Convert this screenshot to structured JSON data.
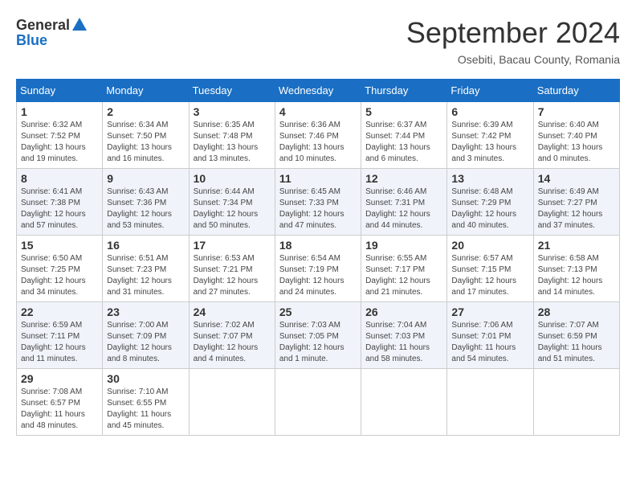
{
  "logo": {
    "general": "General",
    "blue": "Blue"
  },
  "title": "September 2024",
  "subtitle": "Osebiti, Bacau County, Romania",
  "days_header": [
    "Sunday",
    "Monday",
    "Tuesday",
    "Wednesday",
    "Thursday",
    "Friday",
    "Saturday"
  ],
  "weeks": [
    [
      {
        "day": "1",
        "sunrise": "6:32 AM",
        "sunset": "7:52 PM",
        "daylight": "13 hours and 19 minutes."
      },
      {
        "day": "2",
        "sunrise": "6:34 AM",
        "sunset": "7:50 PM",
        "daylight": "13 hours and 16 minutes."
      },
      {
        "day": "3",
        "sunrise": "6:35 AM",
        "sunset": "7:48 PM",
        "daylight": "13 hours and 13 minutes."
      },
      {
        "day": "4",
        "sunrise": "6:36 AM",
        "sunset": "7:46 PM",
        "daylight": "13 hours and 10 minutes."
      },
      {
        "day": "5",
        "sunrise": "6:37 AM",
        "sunset": "7:44 PM",
        "daylight": "13 hours and 6 minutes."
      },
      {
        "day": "6",
        "sunrise": "6:39 AM",
        "sunset": "7:42 PM",
        "daylight": "13 hours and 3 minutes."
      },
      {
        "day": "7",
        "sunrise": "6:40 AM",
        "sunset": "7:40 PM",
        "daylight": "13 hours and 0 minutes."
      }
    ],
    [
      {
        "day": "8",
        "sunrise": "6:41 AM",
        "sunset": "7:38 PM",
        "daylight": "12 hours and 57 minutes."
      },
      {
        "day": "9",
        "sunrise": "6:43 AM",
        "sunset": "7:36 PM",
        "daylight": "12 hours and 53 minutes."
      },
      {
        "day": "10",
        "sunrise": "6:44 AM",
        "sunset": "7:34 PM",
        "daylight": "12 hours and 50 minutes."
      },
      {
        "day": "11",
        "sunrise": "6:45 AM",
        "sunset": "7:33 PM",
        "daylight": "12 hours and 47 minutes."
      },
      {
        "day": "12",
        "sunrise": "6:46 AM",
        "sunset": "7:31 PM",
        "daylight": "12 hours and 44 minutes."
      },
      {
        "day": "13",
        "sunrise": "6:48 AM",
        "sunset": "7:29 PM",
        "daylight": "12 hours and 40 minutes."
      },
      {
        "day": "14",
        "sunrise": "6:49 AM",
        "sunset": "7:27 PM",
        "daylight": "12 hours and 37 minutes."
      }
    ],
    [
      {
        "day": "15",
        "sunrise": "6:50 AM",
        "sunset": "7:25 PM",
        "daylight": "12 hours and 34 minutes."
      },
      {
        "day": "16",
        "sunrise": "6:51 AM",
        "sunset": "7:23 PM",
        "daylight": "12 hours and 31 minutes."
      },
      {
        "day": "17",
        "sunrise": "6:53 AM",
        "sunset": "7:21 PM",
        "daylight": "12 hours and 27 minutes."
      },
      {
        "day": "18",
        "sunrise": "6:54 AM",
        "sunset": "7:19 PM",
        "daylight": "12 hours and 24 minutes."
      },
      {
        "day": "19",
        "sunrise": "6:55 AM",
        "sunset": "7:17 PM",
        "daylight": "12 hours and 21 minutes."
      },
      {
        "day": "20",
        "sunrise": "6:57 AM",
        "sunset": "7:15 PM",
        "daylight": "12 hours and 17 minutes."
      },
      {
        "day": "21",
        "sunrise": "6:58 AM",
        "sunset": "7:13 PM",
        "daylight": "12 hours and 14 minutes."
      }
    ],
    [
      {
        "day": "22",
        "sunrise": "6:59 AM",
        "sunset": "7:11 PM",
        "daylight": "12 hours and 11 minutes."
      },
      {
        "day": "23",
        "sunrise": "7:00 AM",
        "sunset": "7:09 PM",
        "daylight": "12 hours and 8 minutes."
      },
      {
        "day": "24",
        "sunrise": "7:02 AM",
        "sunset": "7:07 PM",
        "daylight": "12 hours and 4 minutes."
      },
      {
        "day": "25",
        "sunrise": "7:03 AM",
        "sunset": "7:05 PM",
        "daylight": "12 hours and 1 minute."
      },
      {
        "day": "26",
        "sunrise": "7:04 AM",
        "sunset": "7:03 PM",
        "daylight": "11 hours and 58 minutes."
      },
      {
        "day": "27",
        "sunrise": "7:06 AM",
        "sunset": "7:01 PM",
        "daylight": "11 hours and 54 minutes."
      },
      {
        "day": "28",
        "sunrise": "7:07 AM",
        "sunset": "6:59 PM",
        "daylight": "11 hours and 51 minutes."
      }
    ],
    [
      {
        "day": "29",
        "sunrise": "7:08 AM",
        "sunset": "6:57 PM",
        "daylight": "11 hours and 48 minutes."
      },
      {
        "day": "30",
        "sunrise": "7:10 AM",
        "sunset": "6:55 PM",
        "daylight": "11 hours and 45 minutes."
      },
      null,
      null,
      null,
      null,
      null
    ]
  ]
}
